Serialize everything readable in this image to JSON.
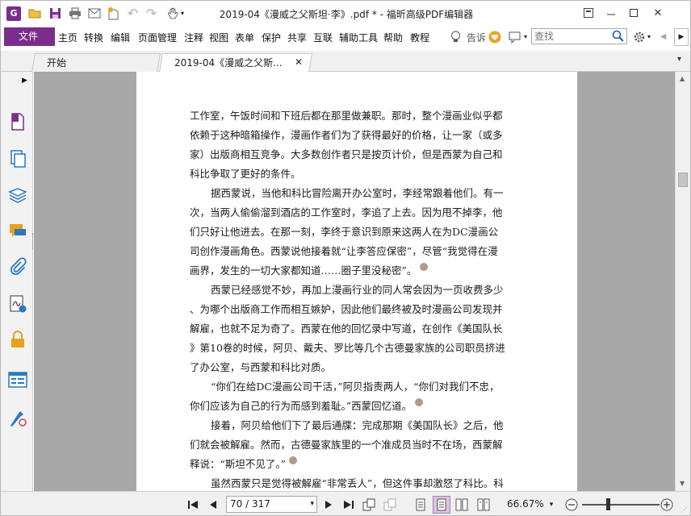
{
  "window": {
    "title": "2019-04《漫威之父斯坦·李》.pdf * - 福昕高级PDF编辑器",
    "logo_letter": "G"
  },
  "menu": {
    "file": "文件",
    "items": [
      "主页",
      "转换",
      "编辑",
      "页面管理",
      "注释",
      "视图",
      "表单",
      "保护",
      "共享",
      "互联",
      "辅助工具",
      "帮助",
      "教程"
    ],
    "tell_me": "告诉",
    "search_placeholder": "查找"
  },
  "tabs": [
    {
      "label": "开始",
      "active": false
    },
    {
      "label": "2019-04《漫威之父斯...",
      "active": true
    }
  ],
  "document": {
    "lines": [
      {
        "text": "工作室，午饭时间和下班后都在那里做兼职。那时，整个漫画业似乎都",
        "indent": false,
        "note": false
      },
      {
        "text": "依赖于这种暗箱操作，漫画作者们为了获得最好的价格，让一家（或多",
        "indent": false,
        "note": false
      },
      {
        "text": "家）出版商相互竞争。大多数创作者只是按页计价，但是西蒙为自己和",
        "indent": false,
        "note": false
      },
      {
        "text": "科比争取了更好的条件。",
        "indent": false,
        "note": false
      },
      {
        "text": "据西蒙说，当他和科比冒险离开办公室时，李经常跟着他们。有一",
        "indent": true,
        "note": false
      },
      {
        "text": "次，当两人偷偷溜到酒店的工作室时，李追了上去。因为甩不掉李，他",
        "indent": false,
        "note": false
      },
      {
        "text": "们只好让他进去。在那一刻，李终于意识到原来这两人在为DC漫画公",
        "indent": false,
        "note": false
      },
      {
        "text": "司创作漫画角色。西蒙说他接着就“让李答应保密”，尽管“我觉得在漫",
        "indent": false,
        "note": false
      },
      {
        "text": "画界，发生的一切大家都知道……圈子里没秘密”。",
        "indent": false,
        "note": true
      },
      {
        "text": "西蒙已经感觉不妙，再加上漫画行业的同人常会因为一页收费多少",
        "indent": true,
        "note": false
      },
      {
        "text": "、为哪个出版商工作而相互嫉妒，因此他们最终被及时漫画公司发现并",
        "indent": false,
        "note": false
      },
      {
        "text": "解雇，也就不足为奇了。西蒙在他的回忆录中写道，在创作《美国队长",
        "indent": false,
        "note": false
      },
      {
        "text": "》第10卷的时候，阿贝、戴夫、罗比等几个古德曼家族的公司职员挤进",
        "indent": false,
        "note": false
      },
      {
        "text": "了办公室，与西蒙和科比对质。",
        "indent": false,
        "note": false
      },
      {
        "text": "“你们在给DC漫画公司干活，”阿贝指责两人，“你们对我们不忠，",
        "indent": true,
        "note": false
      },
      {
        "text": "你们应该为自己的行为而感到羞耻。”西蒙回忆道。",
        "indent": false,
        "note": true
      },
      {
        "text": "接着，阿贝给他们下了最后通牒：完成那期《美国队长》之后，他",
        "indent": true,
        "note": false
      },
      {
        "text": "们就会被解雇。然而，古德曼家族里的一个准成员当时不在场，西蒙解",
        "indent": false,
        "note": false
      },
      {
        "text": "释说：“斯坦不见了。”",
        "indent": false,
        "note": true
      },
      {
        "text": "虽然西蒙只是觉得被解雇“非常丢人”，但这件事却激怒了科比。科",
        "indent": true,
        "note": false
      }
    ]
  },
  "status": {
    "page": "70 / 317",
    "zoom": "66.67%"
  },
  "colors": {
    "accent": "#7b2d8e",
    "doc_bg": "#a8a8a8",
    "sidebar_icon_blue": "#2b78c2",
    "sidebar_icon_orange": "#e8a020"
  }
}
